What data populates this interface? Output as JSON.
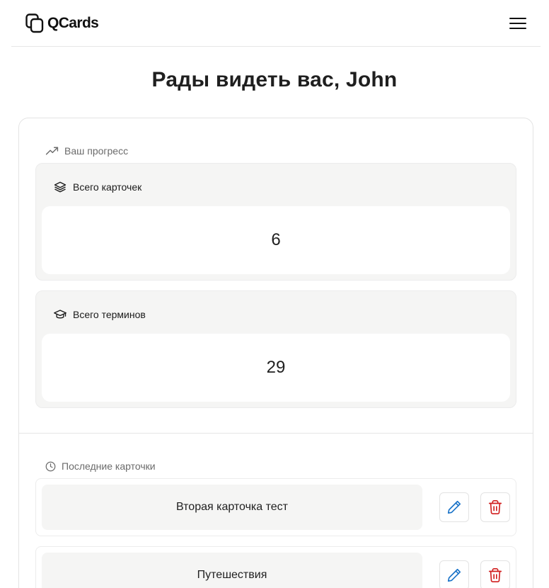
{
  "header": {
    "logo_text": "QCards",
    "logo_icon": "stacked-cards-icon",
    "menu_icon": "hamburger-menu-icon"
  },
  "greeting": "Рады видеть вас, John",
  "progress": {
    "label": "Ваш прогресс",
    "icon": "trending-up-icon",
    "stats": [
      {
        "label": "Всего карточек",
        "value": "6",
        "icon": "layers-icon"
      },
      {
        "label": "Всего терминов",
        "value": "29",
        "icon": "graduation-cap-icon"
      }
    ]
  },
  "recent": {
    "label": "Последние карточки",
    "icon": "clock-icon",
    "items": [
      {
        "name": "Вторая карточка тест"
      },
      {
        "name": "Путешествия"
      }
    ]
  },
  "colors": {
    "edit_icon": "#1a73c8",
    "delete_icon": "#d11f1f",
    "card_bg": "#f5f5f4"
  }
}
